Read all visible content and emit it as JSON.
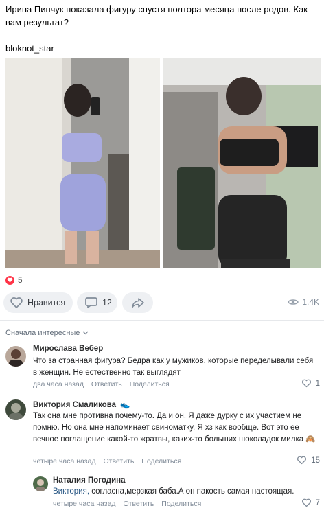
{
  "post": {
    "text_line1": "Ирина Пинчук показала фигуру спустя полтора месяца после родов. Как вам результат?",
    "text_line2": "bloknot_star"
  },
  "reactions": {
    "count": "5"
  },
  "actions": {
    "like_label": "Нравится",
    "comments_count": "12",
    "views": "1.4K"
  },
  "comments_sort": {
    "label": "Сначала интересные"
  },
  "comments": [
    {
      "author": "Мирослава Вебер",
      "text": "Что за странная фигура? Бедра как у мужиков, которые переделывали себя в женщин. Не естественно так выглядят",
      "time": "два часа назад",
      "reply": "Ответить",
      "share": "Поделиться",
      "likes": "1"
    },
    {
      "author": "Виктория Смаликова",
      "text": "Так она мне противна почему-то. Да и он. Я даже дурку с их участием не помню. Но она мне напоминает свиноматку. Я хз как вообще. Вот это ее вечное поглащение какой-то жратвы, каких-то больших шоколадок милка 🙈",
      "time": "четыре часа назад",
      "reply": "Ответить",
      "share": "Поделиться",
      "likes": "15"
    },
    {
      "author": "Наталия Погодина",
      "mention": "Виктория,",
      "text": " согласна,мерзкая баба.А он пакость самая настоящая.",
      "time": "четыре часа назад",
      "reply": "Ответить",
      "share": "Поделиться",
      "likes": "7"
    }
  ],
  "colors": {
    "accent": "#2a5885",
    "like_red": "#ff3347",
    "pill_bg": "#eef0f3",
    "meta": "#818c99"
  }
}
